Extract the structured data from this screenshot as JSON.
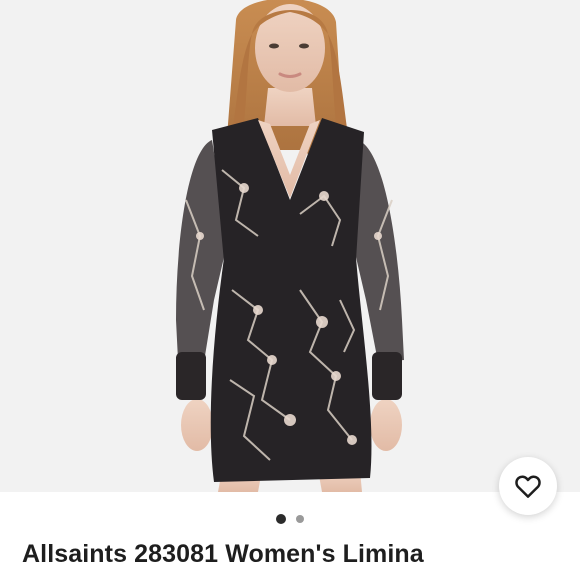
{
  "product": {
    "title": "Allsaints 283081 Women's Limina",
    "image_alt": "Woman wearing a black long-sleeve wrap mini dress with a cracked marble and floral print",
    "image_count": 2,
    "active_image_index": 0
  },
  "like_button": {
    "icon": "heart-outline-icon"
  },
  "colors": {
    "background": "#f2f2f2",
    "dress": "#262326",
    "print_lines": "#d9cfc4",
    "dot_active": "#2b2b2b",
    "dot_inactive": "#9a9a9a"
  }
}
